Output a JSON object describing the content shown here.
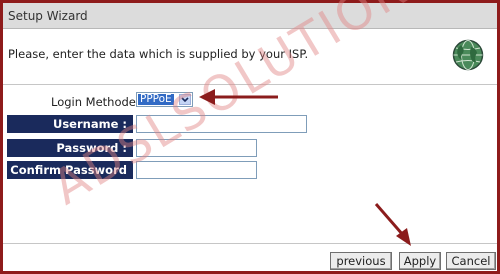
{
  "window": {
    "title": "Setup Wizard"
  },
  "instruction": "Please, enter the data which is supplied by your ISP.",
  "form": {
    "login_method_label": "Login Methode:",
    "login_method_value": "PPPoE",
    "username_label": "Username :",
    "username_value": "",
    "password_label": "Password :",
    "password_value": "",
    "confirm_password_label": "Confirm Password :",
    "confirm_password_value": ""
  },
  "buttons": {
    "previous": "previous",
    "apply": "Apply",
    "cancel": "Cancel"
  },
  "watermark": "ADSLSOLUTION",
  "colors": {
    "frame": "#8e1b1b",
    "label_bg": "#1a2a5c",
    "arrow": "#8b1c1c",
    "select_highlight": "#316ac5"
  }
}
